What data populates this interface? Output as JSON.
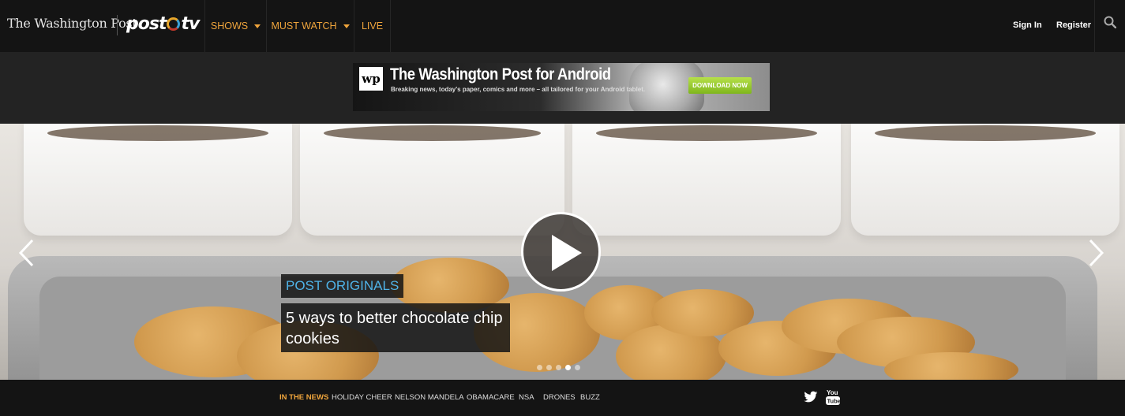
{
  "header": {
    "masthead": "The Washington Post",
    "brand_post": "post",
    "brand_tv": "tv",
    "nav": [
      {
        "label": "SHOWS",
        "dropdown": true
      },
      {
        "label": "MUST WATCH",
        "dropdown": true
      },
      {
        "label": "LIVE",
        "dropdown": false
      }
    ],
    "sign_in": "Sign In",
    "register": "Register",
    "search_icon": "search-icon"
  },
  "ad": {
    "logo": "wp",
    "title": "The Washington Post for Android",
    "subtitle": "Breaking news, today's paper, comics and more – all tailored for your Android tablet.",
    "cta": "DOWNLOAD NOW"
  },
  "hero": {
    "category": "POST ORIGINALS",
    "headline": "5 ways to better chocolate chip cookies",
    "slide_count": 5,
    "active_slide": 4
  },
  "footer": {
    "in_the_news": "IN THE NEWS",
    "links": [
      "HOLIDAY CHEER",
      "NELSON MANDELA",
      "OBAMACARE",
      "NSA",
      "DRONES",
      "BUZZ"
    ],
    "social": [
      "twitter-icon",
      "youtube-icon"
    ]
  },
  "colors": {
    "accent": "#f0a53c",
    "category_blue": "#4fb3e8",
    "topbar": "#141414",
    "adband": "#232323"
  }
}
